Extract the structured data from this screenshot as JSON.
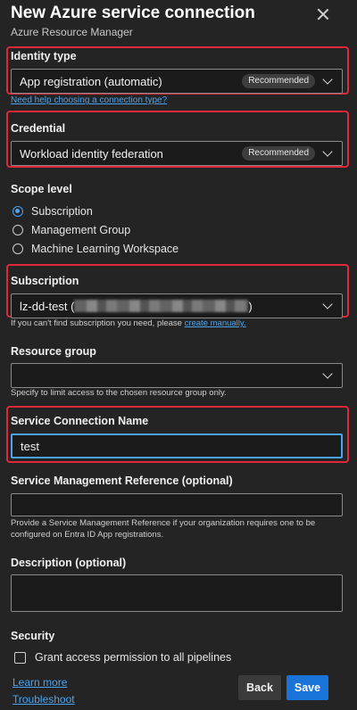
{
  "header": {
    "title": "New Azure service connection",
    "subtitle": "Azure Resource Manager"
  },
  "identity_type": {
    "label": "Identity type",
    "value": "App registration (automatic)",
    "badge": "Recommended",
    "help_link": "Need help choosing a connection type?"
  },
  "credential": {
    "label": "Credential",
    "value": "Workload identity federation",
    "badge": "Recommended"
  },
  "scope_level": {
    "label": "Scope level",
    "options": [
      "Subscription",
      "Management Group",
      "Machine Learning Workspace"
    ],
    "selected": "Subscription"
  },
  "subscription": {
    "label": "Subscription",
    "value_prefix": "lz-dd-test (",
    "value_suffix": ")",
    "help_text": "If you can't find subscription you need, please",
    "help_link": "create manually."
  },
  "resource_group": {
    "label": "Resource group",
    "value": "",
    "help_text": "Specify to limit access to the chosen resource group only."
  },
  "service_connection_name": {
    "label": "Service Connection Name",
    "value": "test"
  },
  "service_management_reference": {
    "label": "Service Management Reference (optional)",
    "value": "",
    "help_line1": "Provide a Service Management Reference if your organization requires one to be",
    "help_line2": "configured on Entra ID App registrations."
  },
  "description": {
    "label": "Description (optional)",
    "value": ""
  },
  "security": {
    "label": "Security",
    "checkbox_label": "Grant access permission to all pipelines",
    "checked": false
  },
  "footer": {
    "learn_more": "Learn more",
    "troubleshoot": "Troubleshoot",
    "back_label": "Back",
    "save_label": "Save"
  },
  "colors": {
    "highlight": "#e0283d",
    "accent": "#1a73d9",
    "link": "#4aa3f0",
    "background": "#242424"
  }
}
